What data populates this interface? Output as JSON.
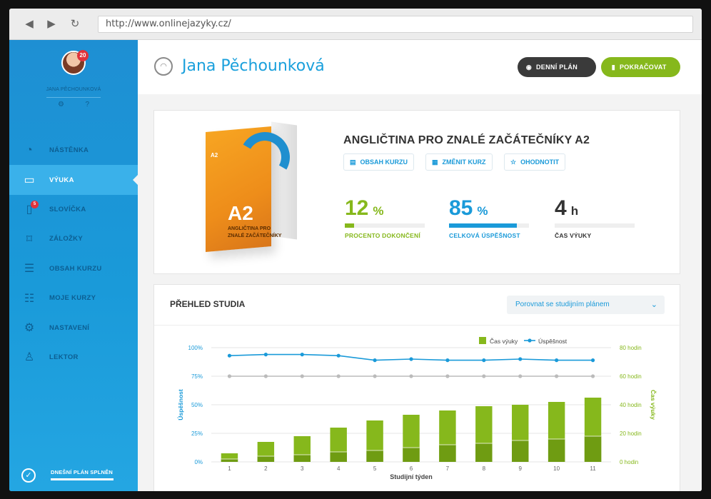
{
  "browser": {
    "back_icon": "back-arrow-icon",
    "forward_icon": "forward-arrow-icon",
    "reload_icon": "reload-icon",
    "url": "http://www.onlinejazyky.cz/"
  },
  "sidebar": {
    "user_name": "JANA PĚCHOUNKOVÁ",
    "avatar_badge": "20",
    "items": [
      {
        "label": "NÁSTĚNKA",
        "icon": "dashboard-icon"
      },
      {
        "label": "VÝUKA",
        "icon": "book-icon",
        "active": true
      },
      {
        "label": "SLOVÍČKA",
        "icon": "vocabulary-icon",
        "badge": "5"
      },
      {
        "label": "ZÁLOŽKY",
        "icon": "bookmark-icon"
      },
      {
        "label": "OBSAH KURZU",
        "icon": "document-icon"
      },
      {
        "label": "MOJE KURZY",
        "icon": "list-icon"
      },
      {
        "label": "NASTAVENÍ",
        "icon": "gear-icon"
      },
      {
        "label": "LEKTOR",
        "icon": "user-icon"
      }
    ],
    "plan_done": "DNEŠNÍ PLÁN SPLNĚN"
  },
  "header": {
    "title": "Jana Pěchounková",
    "daily_plan": "DENNÍ PLÁN",
    "continue": "POKRAČOVAT"
  },
  "course": {
    "box_flag": "A2",
    "box_level": "A2",
    "box_line1": "ANGLIČTINA PRO",
    "box_line2": "ZNALÉ ZAČÁTEČNÍKY",
    "title": "ANGLIČTINA PRO ZNALÉ ZAČÁTEČNÍKY A2",
    "actions": [
      "OBSAH KURZU",
      "ZMĚNIT KURZ",
      "OHODNOTIT"
    ],
    "stats": [
      {
        "value": "12",
        "unit": "%",
        "label": "PROCENTO DOKONČENÍ",
        "fraction": 0.12,
        "color": "#86b81c"
      },
      {
        "value": "85",
        "unit": "%",
        "label": "CELKOVÁ ÚSPĚŠNOST",
        "fraction": 0.85,
        "color": "#1a9ad9"
      },
      {
        "value": "4",
        "unit": "h",
        "label": "ČAS VÝUKY",
        "fraction": 0,
        "color": "#333333"
      }
    ]
  },
  "study": {
    "title": "PŘEHLED STUDIA",
    "compare": "Porovnat se studijním plánem"
  },
  "chart_data": {
    "type": "bar",
    "x": [
      1,
      2,
      3,
      4,
      5,
      6,
      7,
      8,
      9,
      10,
      11
    ],
    "xlabel": "Studijní týden",
    "ylabel_left": "Úspěšnost",
    "ylabel_right": "Čas výuky",
    "ylim_left": [
      0,
      100
    ],
    "ylim_right": [
      0,
      80
    ],
    "left_ticks": [
      "0%",
      "25%",
      "50%",
      "75%",
      "100%"
    ],
    "right_ticks": [
      "0 hodin",
      "20 hodin",
      "40 hodin",
      "60 hodin",
      "80 hodin"
    ],
    "legend": {
      "bars": "Čas výuky",
      "line": "Úspěšnost",
      "placement": "top-right"
    },
    "series": [
      {
        "name": "Čas výuky",
        "kind": "bar",
        "axis": "right",
        "color": "#86b81c",
        "values": [
          6,
          14,
          18,
          24,
          29,
          33,
          36,
          39,
          40,
          42,
          45
        ],
        "inner_values": [
          2,
          4,
          5,
          7,
          8,
          10,
          12,
          13,
          15,
          16,
          18
        ]
      },
      {
        "name": "Úspěšnost",
        "kind": "line",
        "axis": "left",
        "color": "#1a9ad9",
        "values": [
          93,
          94,
          94,
          93,
          89,
          90,
          89,
          89,
          90,
          89,
          89
        ]
      },
      {
        "kind": "line",
        "axis": "left",
        "color": "#bbbbbb",
        "values": [
          75,
          75,
          75,
          75,
          75,
          75,
          75,
          75,
          75,
          75,
          75
        ]
      }
    ]
  }
}
